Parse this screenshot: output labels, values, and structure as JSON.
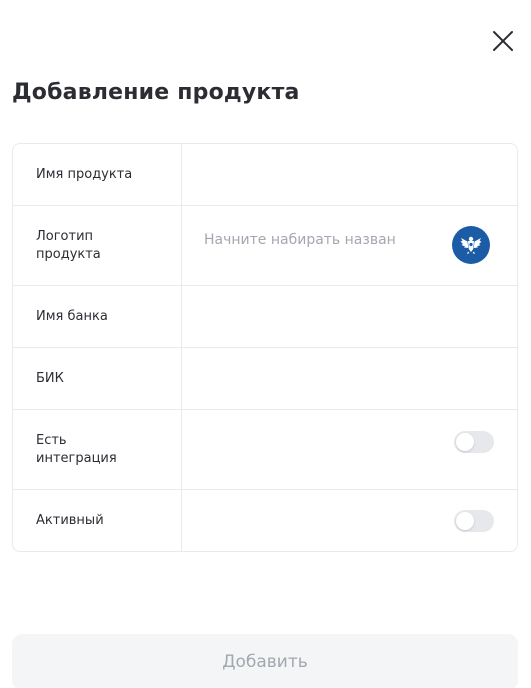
{
  "modal": {
    "title": "Добавление продукта",
    "close_icon": "close-icon"
  },
  "form": {
    "fields": {
      "product_name": {
        "label": "Имя продукта",
        "value": ""
      },
      "product_logo": {
        "label_line1": "Логотип",
        "label_line2": "продукта",
        "placeholder": "Начните набирать назван",
        "icon": "bank-emblem-icon",
        "icon_color": "#1c5ca6"
      },
      "bank_name": {
        "label": "Имя банка",
        "value": ""
      },
      "bik": {
        "label": "БИК",
        "value": ""
      },
      "has_integration": {
        "label_line1": "Есть",
        "label_line2": "интеграция",
        "enabled": false
      },
      "active": {
        "label": "Активный",
        "enabled": false
      }
    }
  },
  "footer": {
    "submit_label": "Добавить",
    "submit_disabled": true
  },
  "colors": {
    "border": "#e8eaee",
    "placeholder_text": "#a3a7b0",
    "toggle_off": "#e6e8ec",
    "button_bg_disabled": "#f4f5f7"
  }
}
